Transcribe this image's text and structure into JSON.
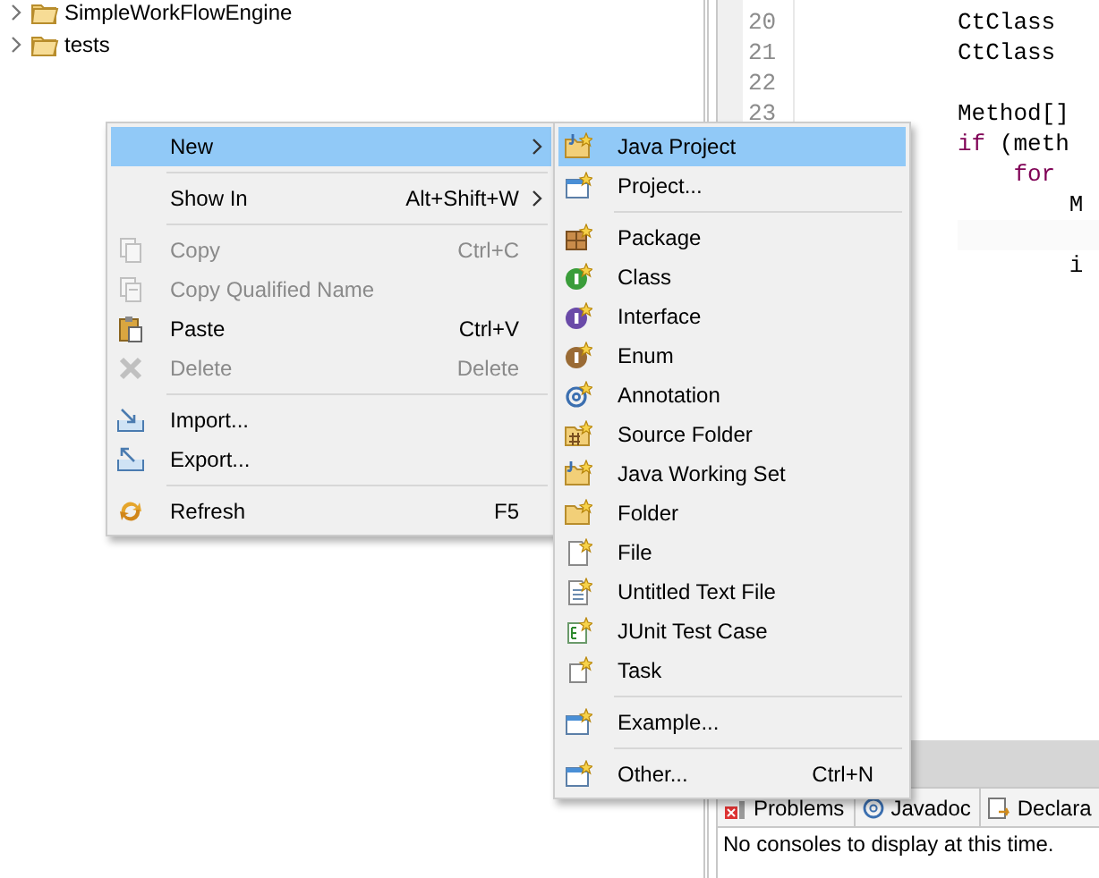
{
  "tree": {
    "items": [
      {
        "label": "SimpleWorkFlowEngine",
        "expanded": false
      },
      {
        "label": "tests",
        "expanded": false
      }
    ]
  },
  "editor": {
    "lines": [
      {
        "number": "20",
        "tokens": [
          {
            "text": "CtClass",
            "kind": "plain"
          }
        ]
      },
      {
        "number": "21",
        "tokens": [
          {
            "text": "CtClass",
            "kind": "plain"
          }
        ]
      },
      {
        "number": "22"
      },
      {
        "number": "23",
        "tokens": [
          {
            "text": "Method[]",
            "kind": "plain"
          }
        ]
      },
      {
        "tokens": [
          {
            "text": "if",
            "kind": "keyword"
          },
          {
            "text": " (meth",
            "kind": "plain"
          }
        ]
      },
      {
        "tokens": [
          {
            "text": "    for",
            "kind": "keyword"
          }
        ]
      },
      {
        "tokens": [
          {
            "text": "        M",
            "kind": "plain"
          }
        ]
      },
      {
        "after_blank": true,
        "tokens": [
          {
            "text": "        i",
            "kind": "plain"
          }
        ]
      }
    ]
  },
  "bottom_panel": {
    "tabs": [
      {
        "label": "Problems"
      },
      {
        "label": "Javadoc"
      },
      {
        "label": "Declara"
      }
    ],
    "message": "No consoles to display at this time."
  },
  "context_menu": {
    "items": [
      {
        "kind": "item",
        "label": "New",
        "submenu": true,
        "selected": true,
        "disabled": false
      },
      {
        "kind": "separator"
      },
      {
        "kind": "item",
        "label": "Show In",
        "shortcut": "Alt+Shift+W",
        "submenu": true,
        "selected": false,
        "disabled": false
      },
      {
        "kind": "separator"
      },
      {
        "kind": "item",
        "label": "Copy",
        "shortcut": "Ctrl+C",
        "submenu": false,
        "selected": false,
        "disabled": true
      },
      {
        "kind": "item",
        "label": "Copy Qualified Name",
        "submenu": false,
        "selected": false,
        "disabled": true
      },
      {
        "kind": "item",
        "label": "Paste",
        "shortcut": "Ctrl+V",
        "submenu": false,
        "selected": false,
        "disabled": false
      },
      {
        "kind": "item",
        "label": "Delete",
        "shortcut": "Delete",
        "submenu": false,
        "selected": false,
        "disabled": true
      },
      {
        "kind": "separator"
      },
      {
        "kind": "item",
        "label": "Import...",
        "submenu": false,
        "selected": false,
        "disabled": false
      },
      {
        "kind": "item",
        "label": "Export...",
        "submenu": false,
        "selected": false,
        "disabled": false
      },
      {
        "kind": "separator"
      },
      {
        "kind": "item",
        "label": "Refresh",
        "shortcut": "F5",
        "submenu": false,
        "selected": false,
        "disabled": false
      }
    ]
  },
  "new_submenu": {
    "items": [
      {
        "kind": "item",
        "label": "Java Project",
        "selected": true,
        "disabled": false
      },
      {
        "kind": "item",
        "label": "Project...",
        "selected": false,
        "disabled": false
      },
      {
        "kind": "separator"
      },
      {
        "kind": "item",
        "label": "Package",
        "selected": false,
        "disabled": false
      },
      {
        "kind": "item",
        "label": "Class",
        "selected": false,
        "disabled": false
      },
      {
        "kind": "item",
        "label": "Interface",
        "selected": false,
        "disabled": false
      },
      {
        "kind": "item",
        "label": "Enum",
        "selected": false,
        "disabled": false
      },
      {
        "kind": "item",
        "label": "Annotation",
        "selected": false,
        "disabled": false
      },
      {
        "kind": "item",
        "label": "Source Folder",
        "selected": false,
        "disabled": false
      },
      {
        "kind": "item",
        "label": "Java Working Set",
        "selected": false,
        "disabled": false
      },
      {
        "kind": "item",
        "label": "Folder",
        "selected": false,
        "disabled": false
      },
      {
        "kind": "item",
        "label": "File",
        "selected": false,
        "disabled": false
      },
      {
        "kind": "item",
        "label": "Untitled Text File",
        "selected": false,
        "disabled": false
      },
      {
        "kind": "item",
        "label": "JUnit Test Case",
        "selected": false,
        "disabled": false
      },
      {
        "kind": "item",
        "label": "Task",
        "selected": false,
        "disabled": false
      },
      {
        "kind": "separator"
      },
      {
        "kind": "item",
        "label": "Example...",
        "selected": false,
        "disabled": false
      },
      {
        "kind": "separator"
      },
      {
        "kind": "item",
        "label": "Other...",
        "shortcut": "Ctrl+N",
        "selected": false,
        "disabled": false
      }
    ]
  }
}
